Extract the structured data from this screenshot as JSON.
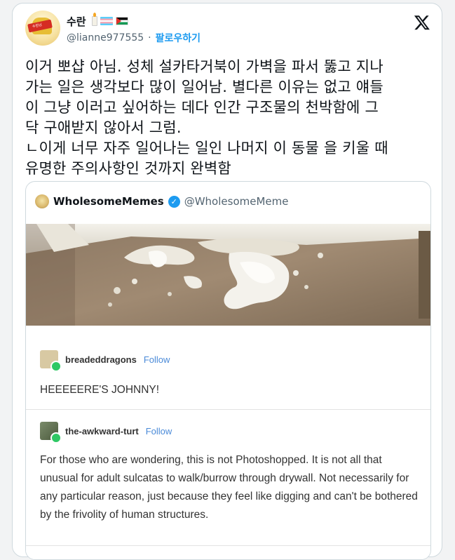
{
  "author": {
    "display_name": "수란",
    "handle": "@lianne977555",
    "separator": "·",
    "follow_label": "팔로우하기",
    "avatar_text": "수란님"
  },
  "tweet": {
    "text": "이거 뽀샵 아님. 성체 설카타거북이 가벽을 파서 뚫고 지나\n가는 일은 생각보다 많이 일어남. 별다른 이유는 없고 얘들\n이 그냥 이러고 싶어하는 데다 인간 구조물의 천박함에 그\n닥 구애받지 않아서 그럼.\nㄴ이게 너무 자주 일어나는 일인 나머지 이 동물 을 키울 때\n유명한 주의사항인 것까지 완벽함"
  },
  "quote": {
    "name": "WholesomeMemes",
    "handle": "@WholesomeMeme",
    "posts": [
      {
        "user": "breadeddragons",
        "follow": "Follow",
        "text": "HEEEEERE'S JOHNNY!"
      },
      {
        "user": "the-awkward-turt",
        "follow": "Follow",
        "text": "For those who are wondering, this is not Photoshopped. It is not all that unusual for adult sulcatas to walk/burrow through drywall. Not necessarily for any particular reason, just because they feel like digging and can't be bothered by the frivolity of human structures."
      }
    ]
  },
  "colors": {
    "accent": "#1d9bf0",
    "tumblr_follow": "#4a8ad8",
    "muted": "#536471"
  }
}
